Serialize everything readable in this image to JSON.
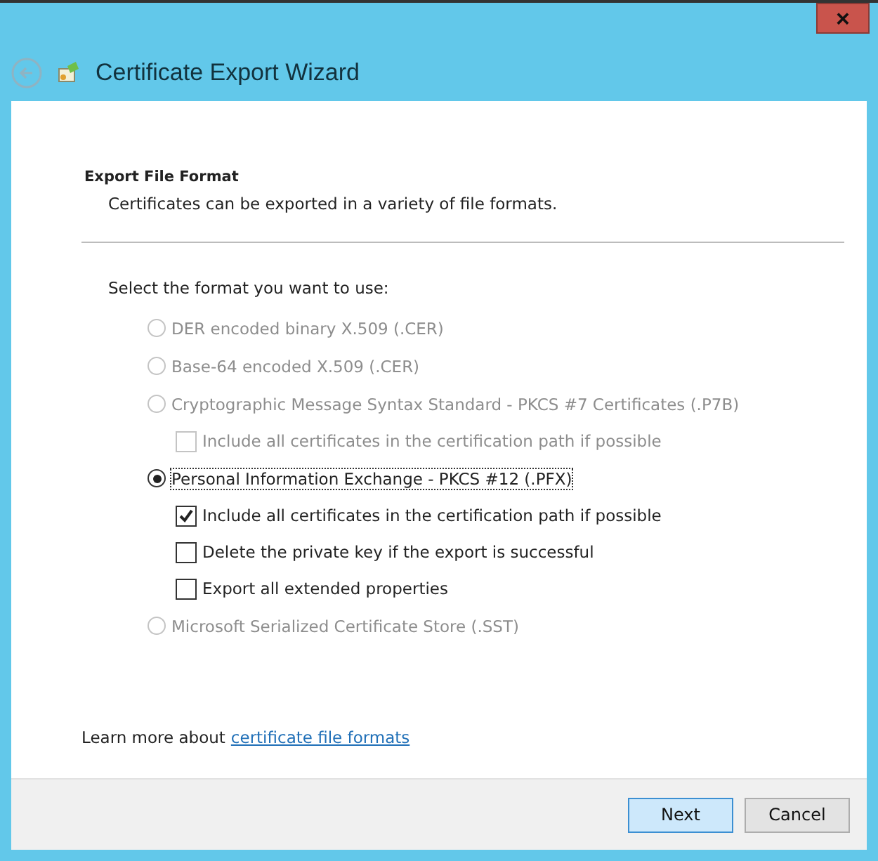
{
  "window": {
    "title": "Certificate Export Wizard",
    "close": "×"
  },
  "header": {
    "title": "Export File Format",
    "subtitle": "Certificates can be exported in a variety of file formats."
  },
  "prompt": "Select the format you want to use:",
  "options": [
    {
      "kind": "radio",
      "label": "DER encoded binary X.509 (.CER)",
      "selected": false,
      "disabled": true
    },
    {
      "kind": "radio",
      "label": "Base-64 encoded X.509 (.CER)",
      "selected": false,
      "disabled": true
    },
    {
      "kind": "radio",
      "label": "Cryptographic Message Syntax Standard - PKCS #7 Certificates (.P7B)",
      "selected": false,
      "disabled": true,
      "children": [
        {
          "kind": "checkbox",
          "label": "Include all certificates in the certification path if possible",
          "checked": false,
          "disabled": true
        }
      ]
    },
    {
      "kind": "radio",
      "label": "Personal Information Exchange - PKCS #12 (.PFX)",
      "selected": true,
      "disabled": false,
      "children": [
        {
          "kind": "checkbox",
          "label": "Include all certificates in the certification path if possible",
          "checked": true,
          "disabled": false
        },
        {
          "kind": "checkbox",
          "label": "Delete the private key if the export is successful",
          "checked": false,
          "disabled": false
        },
        {
          "kind": "checkbox",
          "label": "Export all extended properties",
          "checked": false,
          "disabled": false
        }
      ]
    },
    {
      "kind": "radio",
      "label": "Microsoft Serialized Certificate Store (.SST)",
      "selected": false,
      "disabled": true
    }
  ],
  "learn_more": {
    "text": "Learn more about",
    "link": "certificate file formats"
  },
  "buttons": [
    {
      "label": "Next",
      "kind": "default"
    },
    {
      "label": "Cancel",
      "kind": "normal"
    }
  ]
}
